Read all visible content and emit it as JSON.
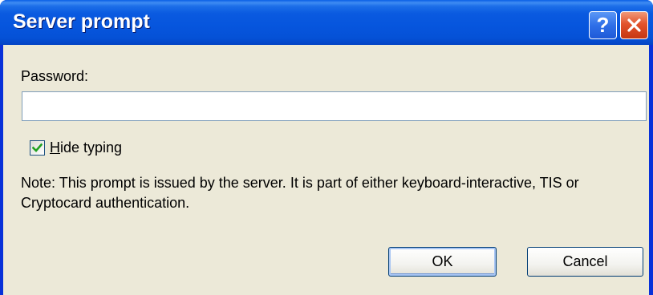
{
  "window": {
    "title": "Server prompt",
    "help_glyph": "?",
    "title_bar_color": "#0a5ae0",
    "close_color": "#e2532c"
  },
  "form": {
    "password_label": "Password:",
    "password_value": "",
    "password_placeholder": "",
    "hide_typing": {
      "checked": true,
      "accelerator": "H",
      "label_rest": "ide typing"
    },
    "note": "Note: This prompt is issued by the server. It is part of either keyboard-interactive, TIS or Cryptocard authentication."
  },
  "buttons": {
    "ok": "OK",
    "cancel": "Cancel"
  },
  "icons": {
    "help": "help-icon",
    "close": "close-icon",
    "check": "checkmark-icon"
  },
  "colors": {
    "dialog_background": "#ece9d8",
    "input_border": "#7f9db9",
    "check_mark": "#21a121"
  }
}
